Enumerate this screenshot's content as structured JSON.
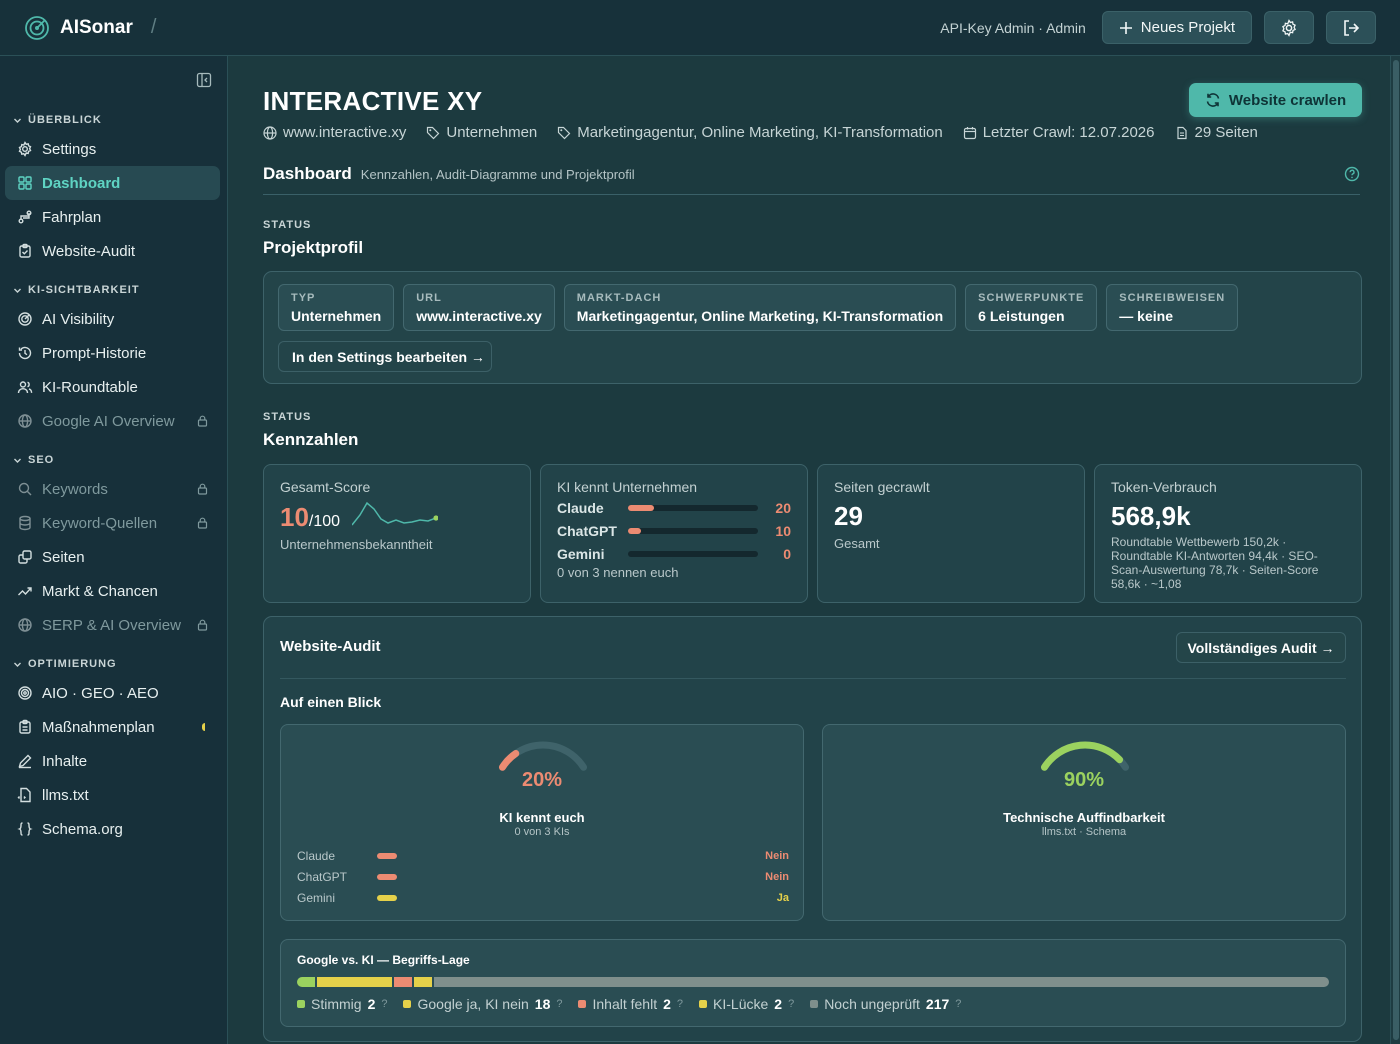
{
  "app": {
    "name": "AISonar",
    "separator": "/"
  },
  "header": {
    "user": "API-Key Admin · Admin",
    "new_project": "Neues Projekt"
  },
  "sidebar": {
    "sections": [
      {
        "title": "ÜBERBLICK",
        "items": [
          {
            "label": "Settings",
            "icon": "gear-icon"
          },
          {
            "label": "Dashboard",
            "icon": "grid-icon",
            "active": true
          },
          {
            "label": "Fahrplan",
            "icon": "route-icon"
          },
          {
            "label": "Website-Audit",
            "icon": "clipboard-icon"
          }
        ]
      },
      {
        "title": "KI-SICHTBARKEIT",
        "items": [
          {
            "label": "AI Visibility",
            "icon": "radar-icon"
          },
          {
            "label": "Prompt-Historie",
            "icon": "history-icon"
          },
          {
            "label": "KI-Roundtable",
            "icon": "users-icon"
          },
          {
            "label": "Google AI Overview",
            "icon": "globe-icon",
            "locked": true
          }
        ]
      },
      {
        "title": "SEO",
        "items": [
          {
            "label": "Keywords",
            "icon": "search-icon",
            "locked": true
          },
          {
            "label": "Keyword-Quellen",
            "icon": "database-icon",
            "locked": true
          },
          {
            "label": "Seiten",
            "icon": "pages-icon"
          },
          {
            "label": "Markt & Chancen",
            "icon": "trend-icon"
          },
          {
            "label": "SERP & AI Overview",
            "icon": "globe-icon",
            "locked": true
          }
        ]
      },
      {
        "title": "OPTIMIERUNG",
        "items": [
          {
            "label": "AIO · GEO · AEO",
            "icon": "target-icon"
          },
          {
            "label": "Maßnahmenplan",
            "icon": "clipboard-list-icon",
            "badge": "half"
          },
          {
            "label": "Inhalte",
            "icon": "pen-icon"
          },
          {
            "label": "llms.txt",
            "icon": "file-code-icon"
          },
          {
            "label": "Schema.org",
            "icon": "braces-icon"
          }
        ]
      }
    ]
  },
  "project": {
    "title": "INTERACTIVE XY",
    "url": "www.interactive.xy",
    "type": "Unternehmen",
    "tags": "Marketingagentur, Online Marketing, KI-Transformation",
    "last_crawl": "Letzter Crawl: 12.07.2026",
    "pages": "29 Seiten",
    "crawl_button": "Website crawlen"
  },
  "dashboard": {
    "title": "Dashboard",
    "subtitle": "Kennzahlen, Audit-Diagramme und Projektprofil"
  },
  "profile": {
    "kicker": "STATUS",
    "title": "Projektprofil",
    "chips": [
      {
        "key": "TYP",
        "value": "Unternehmen"
      },
      {
        "key": "URL",
        "value": "www.interactive.xy"
      },
      {
        "key": "MARKT-DACH",
        "value": "Marketingagentur, Online Marketing, KI-Transformation"
      },
      {
        "key": "SCHWERPUNKTE",
        "value": "6 Leistungen"
      },
      {
        "key": "SCHREIBWEISEN",
        "value": "— keine"
      }
    ],
    "edit_button": "In den Settings bearbeiten →"
  },
  "kpis": {
    "kicker": "STATUS",
    "title": "Kennzahlen",
    "score": {
      "label": "Gesamt-Score",
      "value": "10",
      "max": "/100",
      "sub": "Unternehmensbekanntheit"
    },
    "ki": {
      "label": "KI kennt Unternehmen",
      "rows": [
        {
          "name": "Claude",
          "value": 20,
          "max": 100
        },
        {
          "name": "ChatGPT",
          "value": 10,
          "max": 100
        },
        {
          "name": "Gemini",
          "value": 0,
          "max": 100
        }
      ],
      "sub": "0 von 3 nennen euch"
    },
    "pages": {
      "label": "Seiten gecrawlt",
      "value": "29",
      "sub": "Gesamt"
    },
    "tokens": {
      "label": "Token-Verbrauch",
      "value": "568,9k",
      "sub": "Roundtable Wettbewerb 150,2k · Roundtable KI-Antworten 94,4k · SEO-Scan-Auswertung 78,7k · Seiten-Score 58,6k · ~1,08"
    }
  },
  "audit": {
    "title": "Website-Audit",
    "button": "Vollständiges Audit →",
    "glance": "Auf einen Blick",
    "ki_gauge": {
      "value": 20,
      "label": "20%",
      "caption": "KI kennt euch",
      "sub": "0 von 3 KIs",
      "color": "#ec8b72"
    },
    "llms": [
      {
        "name": "Claude",
        "result": "Nein",
        "color": "#ec8b72"
      },
      {
        "name": "ChatGPT",
        "result": "Nein",
        "color": "#ec8b72"
      },
      {
        "name": "Gemini",
        "result": "Ja",
        "color": "#e5d14a"
      }
    ],
    "tech_gauge": {
      "value": 90,
      "label": "90%",
      "caption": "Technische Auffindbarkeit",
      "sub": "llms.txt · Schema",
      "color": "#9bd25f"
    }
  },
  "gvk": {
    "title": "Google vs. KI — Begriffs-Lage",
    "segments": [
      {
        "label": "Stimmig",
        "count": 2,
        "color": "#9bd25f"
      },
      {
        "label": "Google ja, KI nein",
        "count": 18,
        "color": "#e5d14a"
      },
      {
        "label": "Inhalt fehlt",
        "count": 2,
        "color": "#ec8b72"
      },
      {
        "label": "KI-Lücke",
        "count": 2,
        "color": "#e5d14a"
      },
      {
        "label": "Noch ungeprüft",
        "count": 217,
        "color": "#7f8f8c"
      }
    ]
  }
}
